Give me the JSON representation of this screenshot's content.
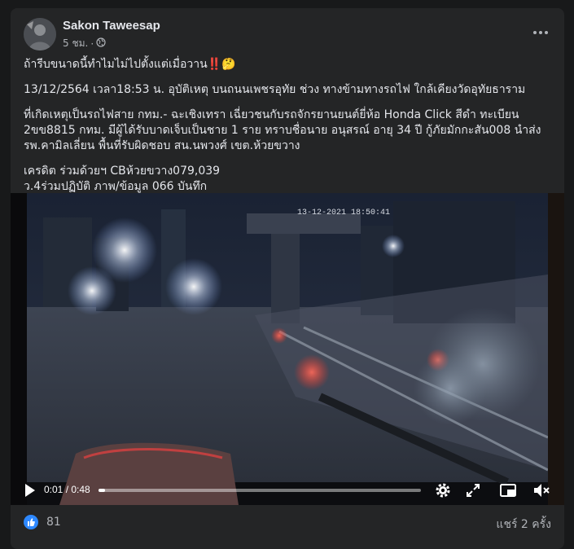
{
  "post": {
    "author": "Sakon Taweesap",
    "time_label": "5 ชม.",
    "separator": "·",
    "privacy_icon": "globe-icon",
    "more_icon": "more-horizontal-icon",
    "text": {
      "line1": "ถ้ารีบขนาดนี้ทำไมไม่ไปตั้งแต่เมื่อวาน",
      "line1_emoji": "‼️🤔",
      "para2": "13/12/2564 เวลา18:53 น. อุบัติเหตุ บนถนนเพชรอุทัย ช่วง ทางข้ามทางรถไฟ ใกล้เคียงวัดอุทัยธาราม",
      "para3": "ที่เกิดเหตุเป็นรถไฟสาย กทม.- ฉะเชิงเทรา เฉี่ยวชนกับรถจักรยานยนต์ยี่ห้อ Honda Click สีดำ ทะเบียน 2ขข8815 กทม. มีผู้ได้รับบาดเจ็บเป็นชาย 1 ราย ทราบชื่อนาย อนุสรณ์ อายุ 34 ปี กู้ภัยมักกะสัน008 นำส่ง รพ.คามิลเลี่ยน พื้นที่รับผิดชอบ สน.นพวงศ์ เขต.ห้วยขวาง",
      "credit1": "เครดิต ร่วมด้วยฯ CBห้วยขวาง079,039",
      "credit2": "ว.4ร่วมปฏิบัติ ภาพ/ข้อมูล 066 บันทึก"
    }
  },
  "video": {
    "timestamp_overlay": "13-12-2021 18:50:41",
    "current_time": "0:01",
    "duration": "0:48",
    "time_label": "0:01 / 0:48",
    "progress": 0.021,
    "controls": [
      "play-icon",
      "settings-icon",
      "fullscreen-icon",
      "pip-icon",
      "volume-icon"
    ]
  },
  "footer": {
    "reaction_icon": "like-icon",
    "like_count": "81",
    "shares_label": "แชร์ 2 ครั้ง"
  },
  "colors": {
    "background": "#18191a",
    "card": "#242526",
    "text_primary": "#e4e6eb",
    "text_secondary": "#b0b3b8",
    "like_blue": "#2d88ff"
  }
}
